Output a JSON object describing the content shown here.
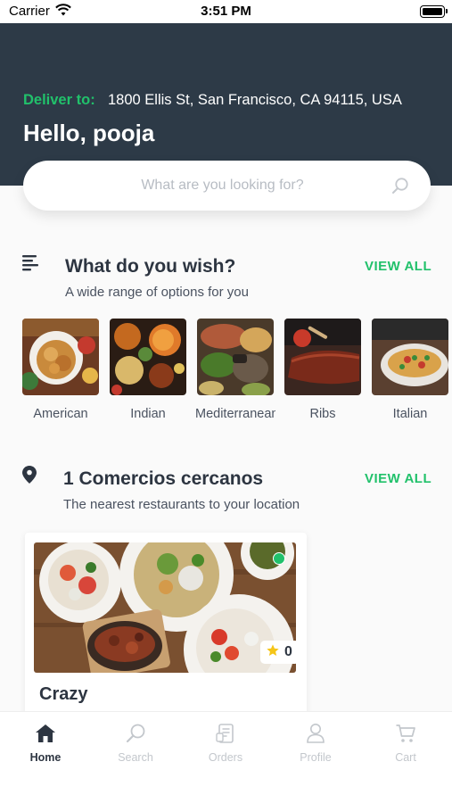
{
  "status_bar": {
    "carrier": "Carrier",
    "time": "3:51 PM"
  },
  "header": {
    "deliver_label": "Deliver to:",
    "address": "1800 Ellis St, San Francisco, CA 94115, USA",
    "greeting": "Hello, pooja"
  },
  "search": {
    "placeholder": "What are you looking for?",
    "value": ""
  },
  "categories_section": {
    "title": "What do you wish?",
    "subtitle": "A wide range of options for you",
    "view_all": "VIEW ALL",
    "items": [
      {
        "label": "American"
      },
      {
        "label": "Indian"
      },
      {
        "label": "Mediterranean"
      },
      {
        "label": "Ribs"
      },
      {
        "label": "Italian"
      }
    ]
  },
  "nearby_section": {
    "title": "1 Comercios cercanos",
    "subtitle": "The nearest restaurants to your location",
    "view_all": "VIEW ALL",
    "restaurants": [
      {
        "name": "Crazy",
        "rating": "0",
        "open_status_color": "#21c16b"
      }
    ]
  },
  "tab_bar": {
    "tabs": [
      {
        "label": "Home",
        "icon": "home-icon",
        "active": true
      },
      {
        "label": "Search",
        "icon": "search-icon",
        "active": false
      },
      {
        "label": "Orders",
        "icon": "orders-icon",
        "active": false
      },
      {
        "label": "Profile",
        "icon": "profile-icon",
        "active": false
      },
      {
        "label": "Cart",
        "icon": "cart-icon",
        "active": false
      }
    ]
  },
  "colors": {
    "accent": "#21c16b",
    "header_bg": "#2d3a47",
    "text_dark": "#2d3541"
  }
}
